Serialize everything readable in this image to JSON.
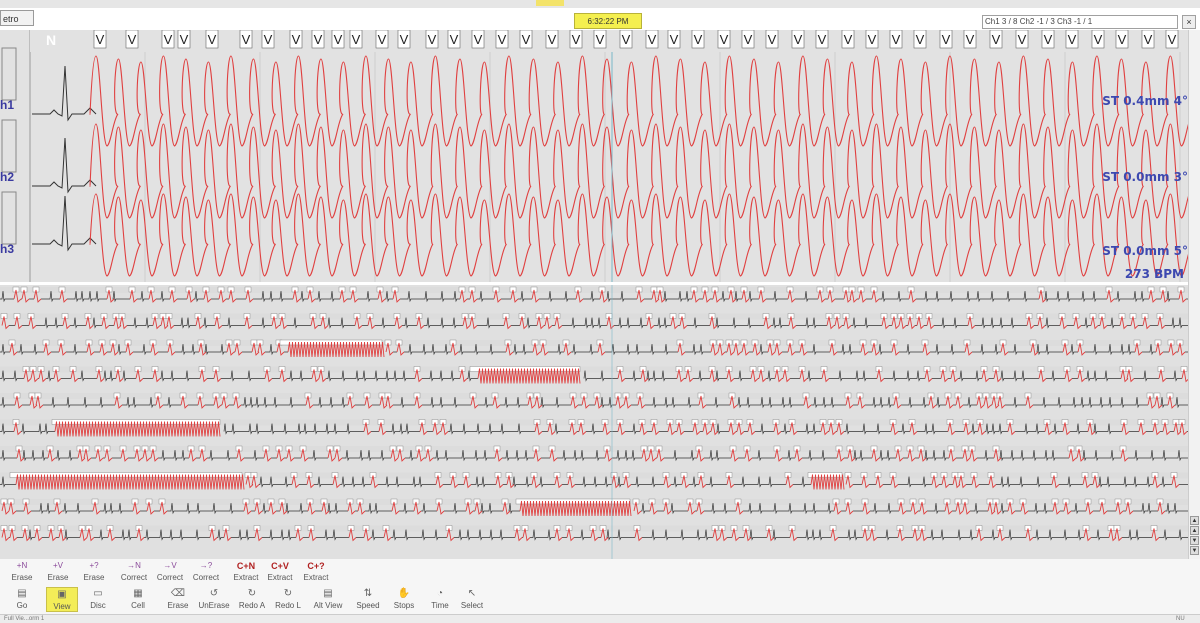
{
  "window": {
    "retro_label": "etro",
    "clock": "6:32:22 PM"
  },
  "channel_info": {
    "text": "Ch1   3  /  8  Ch2   -1  /  3  Ch3   -1  /  1"
  },
  "close_label": "×",
  "upper_view": {
    "beat_n_label": "N",
    "beat_marker": "V",
    "channels": [
      {
        "label": "h1",
        "st": "ST 0.4mm  4°"
      },
      {
        "label": "h2",
        "st": "ST 0.0mm  3°"
      },
      {
        "label": "h3",
        "st": "ST 0.0mm  5°"
      }
    ],
    "heart_rate": "273 BPM"
  },
  "colors": {
    "trace": "#e04040",
    "normal": "#333333",
    "st_text": "#3d49b0",
    "clock_bg": "#f4ef4f",
    "active_bg": "#f3ed58"
  },
  "toolbar_edit": [
    {
      "icon": "+N",
      "label": "Erase"
    },
    {
      "icon": "+V",
      "label": "Erase"
    },
    {
      "icon": "+?",
      "label": "Erase"
    },
    {
      "icon": "→N",
      "label": "Correct"
    },
    {
      "icon": "→V",
      "label": "Correct"
    },
    {
      "icon": "→?",
      "label": "Correct"
    },
    {
      "icon": "C+N",
      "label": "Extract"
    },
    {
      "icon": "C+V",
      "label": "Extract"
    },
    {
      "icon": "C+?",
      "label": "Extract"
    }
  ],
  "toolbar_main": [
    {
      "icon": "printer-icon",
      "label": "Go",
      "active": false
    },
    {
      "icon": "view-icon",
      "label": "View",
      "active": true
    },
    {
      "icon": "disc-icon",
      "label": "Disc",
      "active": false
    },
    {
      "icon": "cell-icon",
      "label": "Cell",
      "active": false
    },
    {
      "icon": "erase-icon",
      "label": "Erase",
      "active": false
    },
    {
      "icon": "unerase-icon",
      "label": "UnErase",
      "active": false
    },
    {
      "icon": "redo-a-icon",
      "label": "Redo A",
      "active": false
    },
    {
      "icon": "redo-l-icon",
      "label": "Redo L",
      "active": false
    },
    {
      "icon": "alt-view-icon",
      "label": "Alt View",
      "active": false
    },
    {
      "icon": "speed-icon",
      "label": "Speed",
      "active": false
    },
    {
      "icon": "stops-icon",
      "label": "Stops",
      "active": false
    },
    {
      "icon": "time-icon",
      "label": "Time",
      "active": false
    },
    {
      "icon": "select-icon",
      "label": "Select",
      "active": false
    }
  ],
  "status": {
    "left": "Full Vie...orm 1",
    "right": "NU"
  }
}
